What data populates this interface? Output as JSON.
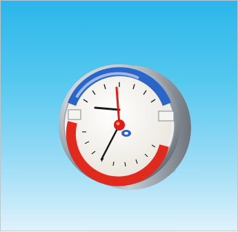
{
  "image": {
    "subject": "thermomanometer",
    "colors": {
      "background_top": "#2bb6ea",
      "background_bottom": "#dff2fb",
      "pressure_arc": "#2a66c8",
      "temperature_arc": "#e02a1d",
      "dial_face": "#f6f3ec",
      "needle_red": "#e11b12",
      "needle_black": "#1a1a1a",
      "bezel": "#c9ced3"
    },
    "icons": {
      "pressure_scale": "pressure-scale-icon",
      "temperature_scale": "temperature-scale-icon",
      "logo": "brand-logo-icon"
    }
  }
}
